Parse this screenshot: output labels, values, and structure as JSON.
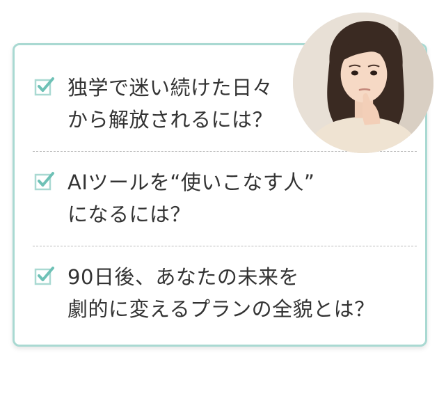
{
  "items": [
    {
      "lines": [
        "独学で迷い続けた日々",
        "から解放されるには？"
      ]
    },
    {
      "lines": [
        "AIツールを“使いこなす人”",
        "になるには？"
      ]
    },
    {
      "lines": [
        "90日後、あなたの未来を",
        "劇的に変えるプランの全貌とは？"
      ]
    }
  ],
  "colors": {
    "card_border": "#a9d9d2",
    "check_box": "#a9d9d2",
    "check_mark": "#6ec1b6",
    "text": "#333333",
    "divider": "#b9b9b9"
  },
  "icons": {
    "checkbox": "checkbox-checked-icon",
    "avatar": "thinking-woman-photo"
  }
}
